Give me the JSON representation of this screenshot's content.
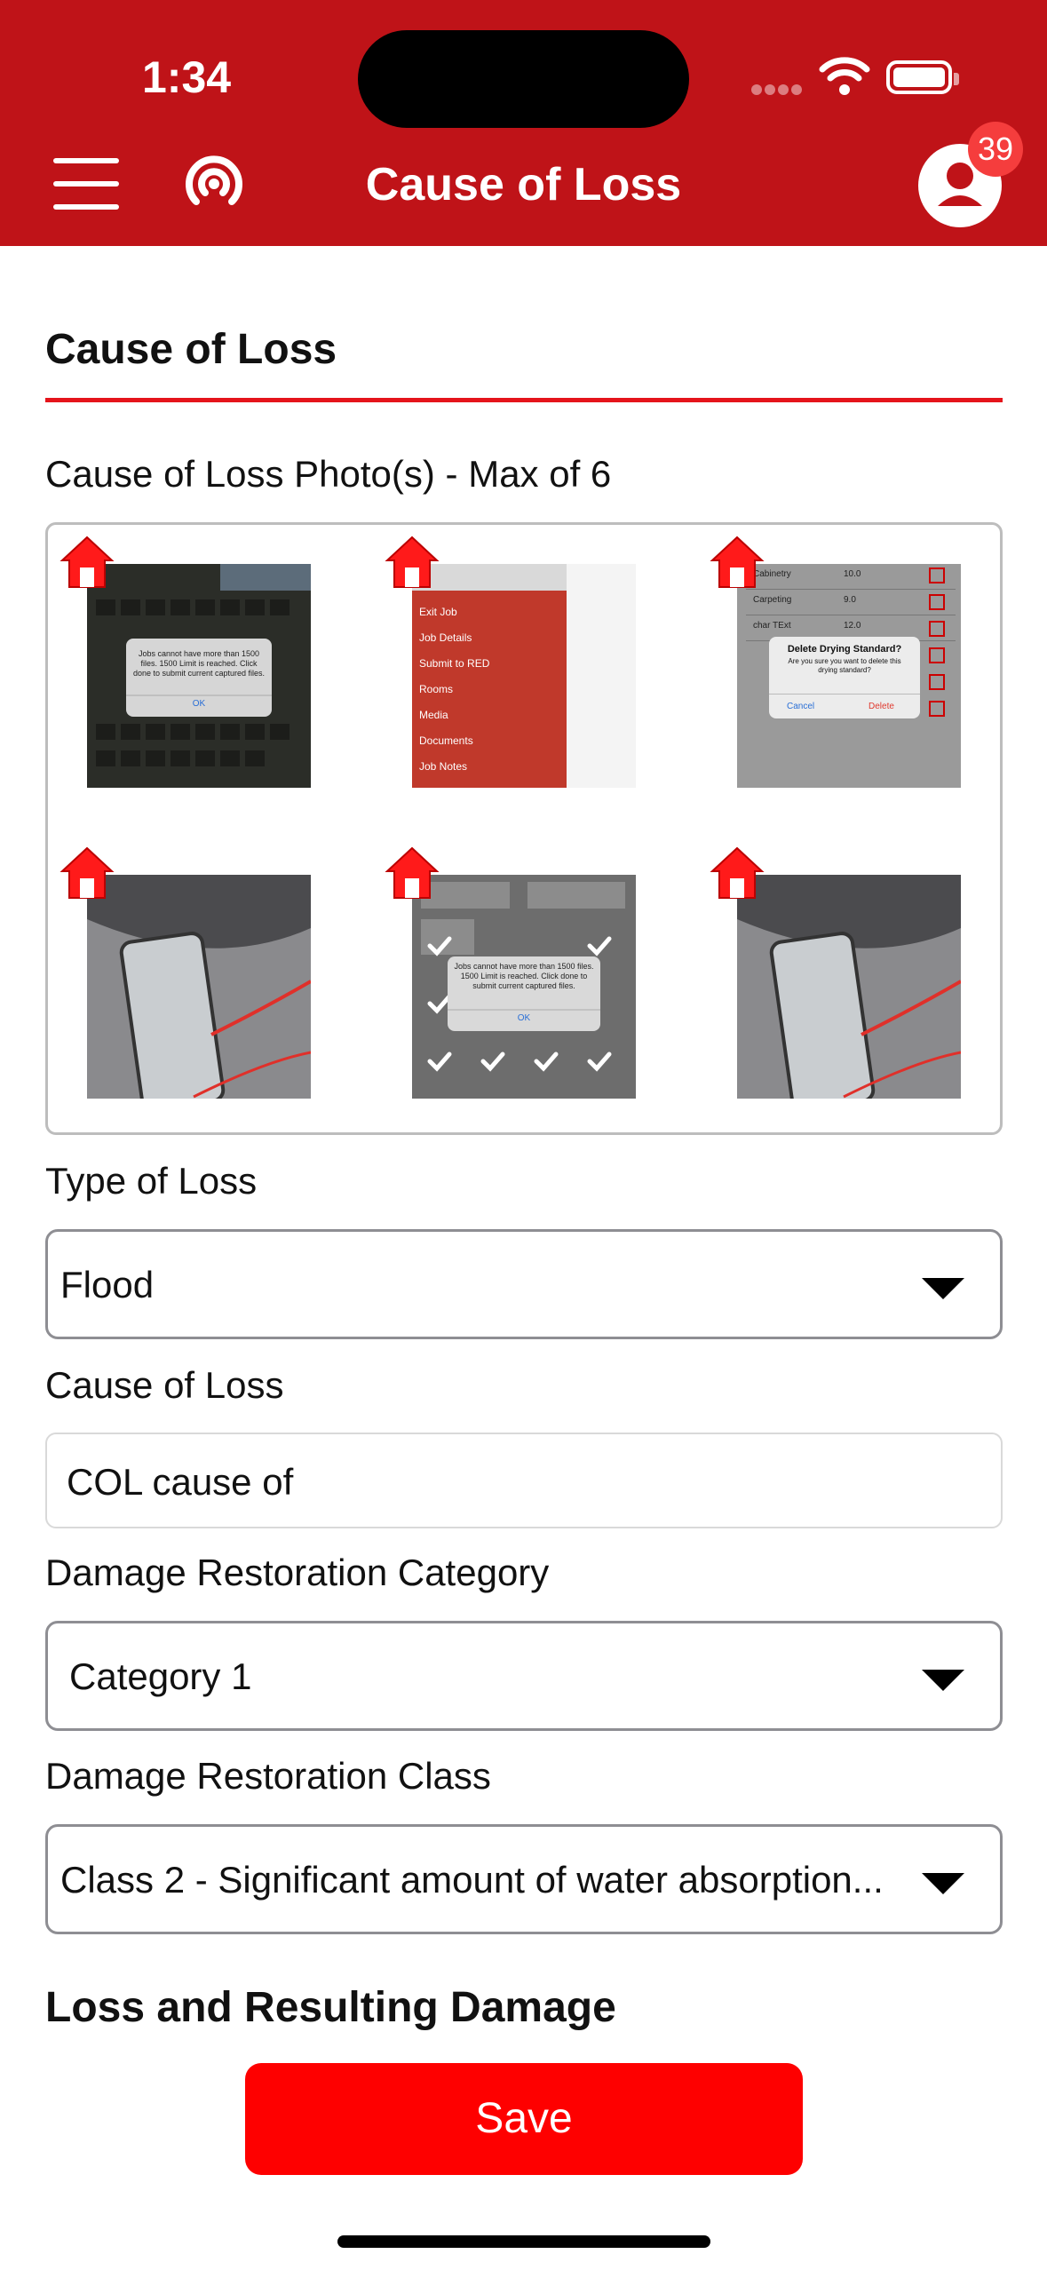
{
  "status_bar": {
    "time": "1:34"
  },
  "header": {
    "title": "Cause of Loss",
    "notification_count": "39"
  },
  "section": {
    "title": "Cause of Loss"
  },
  "photos": {
    "label": "Cause of Loss Photo(s) - Max of 6",
    "dialog_text": "Jobs cannot have more than 1500 files. 1500 Limit is reached. Click done to submit current captured files.",
    "dialog_ok": "OK",
    "menu_items": [
      "Exit Job",
      "Job Details",
      "Submit to RED",
      "Rooms",
      "Media",
      "Documents",
      "Job Notes"
    ],
    "table_rows": [
      {
        "name": "Cabinetry",
        "value": "10.0"
      },
      {
        "name": "Carpeting",
        "value": "9.0"
      },
      {
        "name": "char TExt",
        "value": "12.0"
      }
    ],
    "confirm_title": "Delete Drying Standard?",
    "confirm_text": "Are you sure you want to delete this drying standard?",
    "confirm_cancel": "Cancel",
    "confirm_delete": "Delete"
  },
  "type_of_loss": {
    "label": "Type of Loss",
    "value": "Flood"
  },
  "cause_of_loss": {
    "label": "Cause of Loss",
    "value": "COL cause of"
  },
  "category": {
    "label": "Damage Restoration Category",
    "value": "Category 1"
  },
  "class": {
    "label": "Damage Restoration Class",
    "value": "Class 2 - Significant amount of water absorption..."
  },
  "loss_damage": {
    "heading": "Loss and Resulting Damage"
  },
  "actions": {
    "save_label": "Save"
  },
  "colors": {
    "header_red": "#bf1318",
    "accent_red": "#e5141b",
    "save_red": "#fe0000",
    "badge_red": "#f53d3d"
  }
}
